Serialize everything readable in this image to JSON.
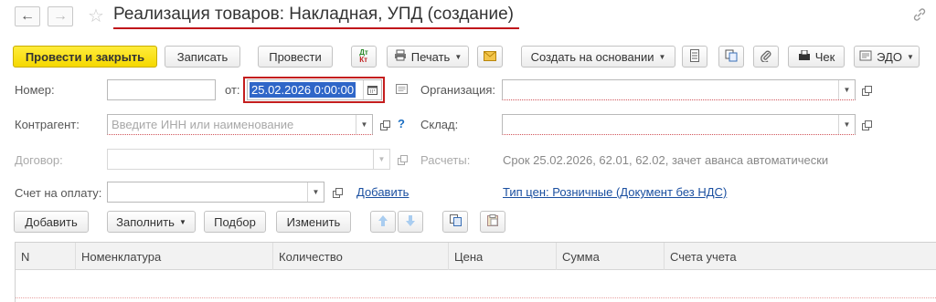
{
  "title": "Реализация товаров: Накладная, УПД (создание)",
  "nav": {
    "back_icon": "←",
    "forward_icon": "→",
    "star_icon": "☆",
    "link_icon": "🔗"
  },
  "toolbar": {
    "post_close": "Провести и закрыть",
    "save": "Записать",
    "post": "Провести",
    "dtkt_dt": "Дт",
    "dtkt_kt": "Кт",
    "print": "Печать",
    "create_based": "Создать на основании",
    "check": "Чек",
    "edo": "ЭДО"
  },
  "form": {
    "number_label": "Номер:",
    "number_value": "",
    "from_label": "от:",
    "date_value": "25.02.2026  0:00:00",
    "org_label": "Организация:",
    "org_value": "",
    "counterparty_label": "Контрагент:",
    "counterparty_placeholder": "Введите ИНН или наименование",
    "help": "?",
    "warehouse_label": "Склад:",
    "warehouse_value": "",
    "contract_label": "Договор:",
    "contract_value": "",
    "settlements_label": "Расчеты:",
    "settlements_value": "Срок 25.02.2026, 62.01, 62.02, зачет аванса автоматически",
    "invoice_label": "Счет на оплату:",
    "invoice_value": "",
    "add_link": "Добавить",
    "price_type_link": "Тип цен: Розничные (Документ без НДС)"
  },
  "table_toolbar": {
    "add": "Добавить",
    "fill": "Заполнить",
    "pick": "Подбор",
    "change": "Изменить"
  },
  "table": {
    "columns": [
      "N",
      "Номенклатура",
      "Количество",
      "Цена",
      "Сумма",
      "Счета учета"
    ],
    "rows": []
  }
}
